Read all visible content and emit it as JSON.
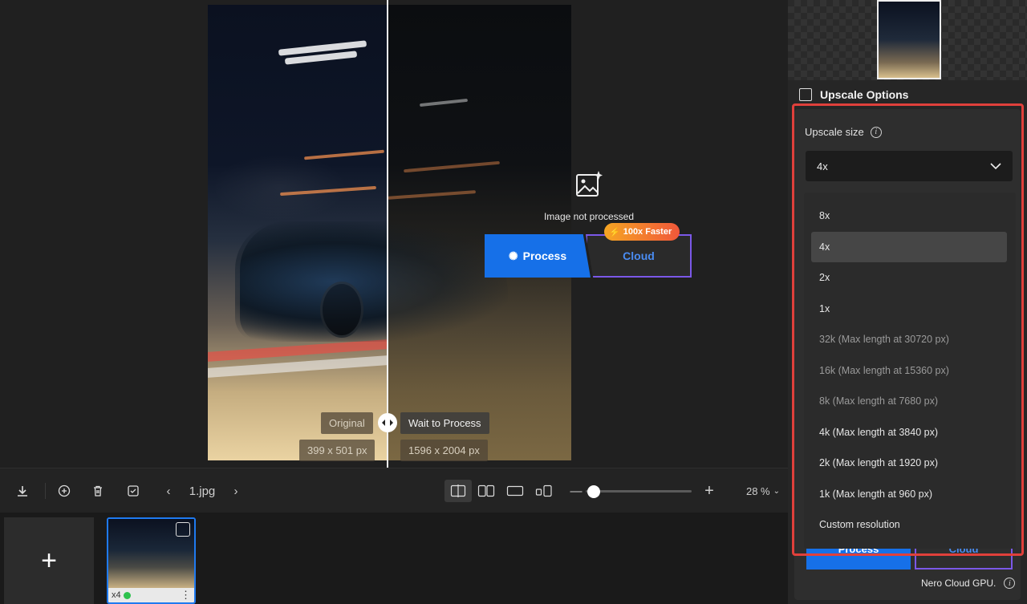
{
  "preview": {
    "status_text": "Image not processed",
    "process_label": "Process",
    "cloud_label": "Cloud",
    "badge_label": "100x Faster",
    "original_tag": "Original",
    "processed_tag": "Wait to Process",
    "original_size": "399 x 501 px",
    "processed_size": "1596 x 2004 px"
  },
  "toolbar": {
    "file_name": "1.jpg",
    "zoom": "28 %",
    "zoom_level": 0.28
  },
  "thumbnails": [
    {
      "scale_label": "x4",
      "status": "ready"
    }
  ],
  "panel": {
    "section_title": "Upscale Options",
    "upscale_size_label": "Upscale size",
    "selected_value": "4x",
    "options": [
      {
        "label": "8x",
        "muted": false
      },
      {
        "label": "4x",
        "muted": false,
        "selected": true
      },
      {
        "label": "2x",
        "muted": false
      },
      {
        "label": "1x",
        "muted": false
      },
      {
        "label": "32k (Max length at 30720 px)",
        "muted": true
      },
      {
        "label": "16k (Max length at 15360 px)",
        "muted": true
      },
      {
        "label": "8k (Max length at 7680 px)",
        "muted": true
      },
      {
        "label": "4k (Max length at 3840 px)",
        "muted": false
      },
      {
        "label": "2k (Max length at 1920 px)",
        "muted": false
      },
      {
        "label": "1k (Max length at 960 px)",
        "muted": false
      },
      {
        "label": "Custom resolution",
        "muted": false
      }
    ],
    "process_label": "Process",
    "cloud_label": "Cloud",
    "footnote": "Nero Cloud GPU."
  },
  "colors": {
    "accent_blue": "#1670e8",
    "cloud_border": "#7b58e8",
    "highlight_red": "#e0403b",
    "status_green": "#2ec24e"
  }
}
